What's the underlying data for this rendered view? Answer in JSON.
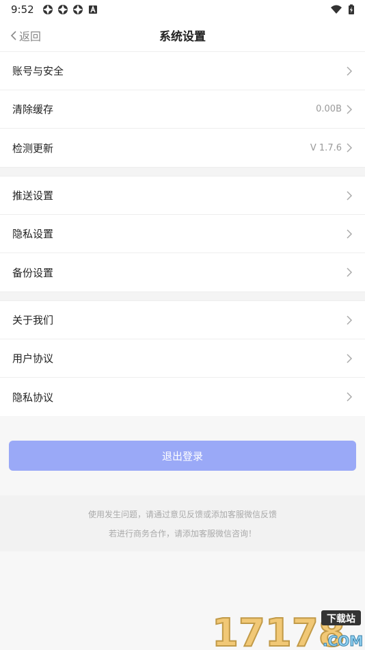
{
  "status_bar": {
    "time": "9:52",
    "left_icons": [
      "app-notification-icon",
      "app-notification-icon",
      "app-notification-icon",
      "a-letter-icon"
    ],
    "right_icons": [
      "wifi-icon",
      "battery-icon"
    ]
  },
  "header": {
    "back_label": "返回",
    "title": "系统设置"
  },
  "groups": [
    [
      {
        "label": "账号与安全",
        "value": ""
      },
      {
        "label": "清除缓存",
        "value": "0.00B"
      },
      {
        "label": "检测更新",
        "value": "V 1.7.6"
      }
    ],
    [
      {
        "label": "推送设置",
        "value": ""
      },
      {
        "label": "隐私设置",
        "value": ""
      },
      {
        "label": "备份设置",
        "value": ""
      }
    ],
    [
      {
        "label": "关于我们",
        "value": ""
      },
      {
        "label": "用户协议",
        "value": ""
      },
      {
        "label": "隐私协议",
        "value": ""
      }
    ]
  ],
  "logout_label": "退出登录",
  "footer": {
    "line1": "使用发生问题，请通过意见反馈或添加客服微信反馈",
    "line2": "若进行商务合作，请添加客服微信咨询！"
  },
  "watermark": {
    "number": "17178",
    "badge": "下载站",
    "domain": ".COM"
  },
  "colors": {
    "accent": "#9aa9f7",
    "background": "#f7f7f7"
  }
}
